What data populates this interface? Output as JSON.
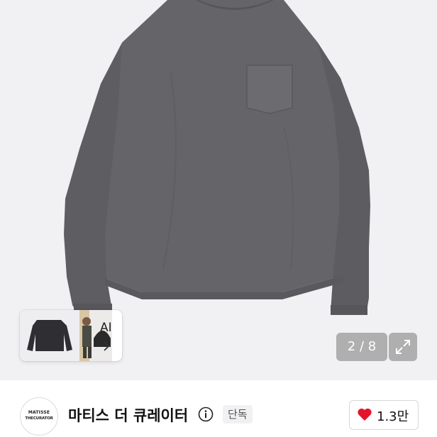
{
  "gallery": {
    "product_image": "gray-long-sleeve-pocket-tee",
    "ai_thumbnails": [
      "dark-sweatshirt-thumbnail",
      "model-outfit-thumbnail"
    ],
    "ai_label": "AI",
    "ai_chevron_icon": "chevron-right-icon",
    "counter_text": "2 / 8",
    "expand_icon": "expand-icon"
  },
  "seller": {
    "logo_line1": "MATISSE",
    "logo_line2": "THECURATOR",
    "name": "마티스 더 큐레이터",
    "info_icon": "info-icon",
    "badge": "단독"
  },
  "like": {
    "icon": "heart-icon",
    "count": "1.3만"
  },
  "colors": {
    "shirt": "#646469",
    "background": "#f1f1f3",
    "heart": "#e5132a"
  }
}
